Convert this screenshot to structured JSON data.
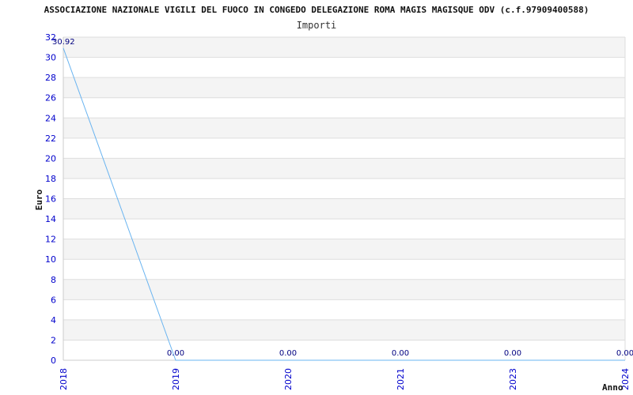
{
  "chart_data": {
    "type": "line",
    "title": "ASSOCIAZIONE NAZIONALE VIGILI DEL FUOCO IN CONGEDO DELEGAZIONE ROMA MAGIS MAGISQUE ODV (c.f.97909400588)",
    "subtitle": "Importi",
    "xlabel": "Anno",
    "ylabel": "Euro",
    "categories": [
      "2018",
      "2019",
      "2020",
      "2021",
      "2023",
      "2024"
    ],
    "series": [
      {
        "values": [
          30.92,
          0,
          0,
          0,
          0,
          0
        ],
        "labels": [
          "30.92",
          "0.00",
          "0.00",
          "0.00",
          "0.00",
          "0.00"
        ]
      }
    ],
    "ylim": [
      0,
      32
    ],
    "yticks": [
      "0",
      "2",
      "4",
      "6",
      "8",
      "10",
      "12",
      "14",
      "16",
      "18",
      "20",
      "22",
      "24",
      "26",
      "28",
      "30",
      "32"
    ],
    "grid": true,
    "legend": "none",
    "colors": {
      "line": "#6ab4f0",
      "band": "#f4f4f4",
      "grid": "#dddddd",
      "tick_text": "#0000cc",
      "value_label": "#000080"
    }
  }
}
